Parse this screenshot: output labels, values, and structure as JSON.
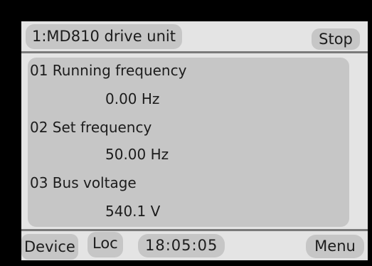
{
  "header": {
    "device_title": "1:MD810 drive unit",
    "run_status": "Stop"
  },
  "parameters": [
    {
      "name": "01 Running frequency",
      "value": "0.00 Hz"
    },
    {
      "name": "02 Set frequency",
      "value": "50.00 Hz"
    },
    {
      "name": "03 Bus voltage",
      "value": "540.1 V"
    }
  ],
  "footer": {
    "device_label": "Device",
    "loc_label": "Loc",
    "clock": "18:05:05",
    "menu_label": "Menu"
  },
  "colors": {
    "bezel": "#000000",
    "screen_background": "#e4e4e4",
    "pill_background": "#c6c6c6",
    "divider": "#7a7a7a",
    "text": "#1c1c1c"
  }
}
